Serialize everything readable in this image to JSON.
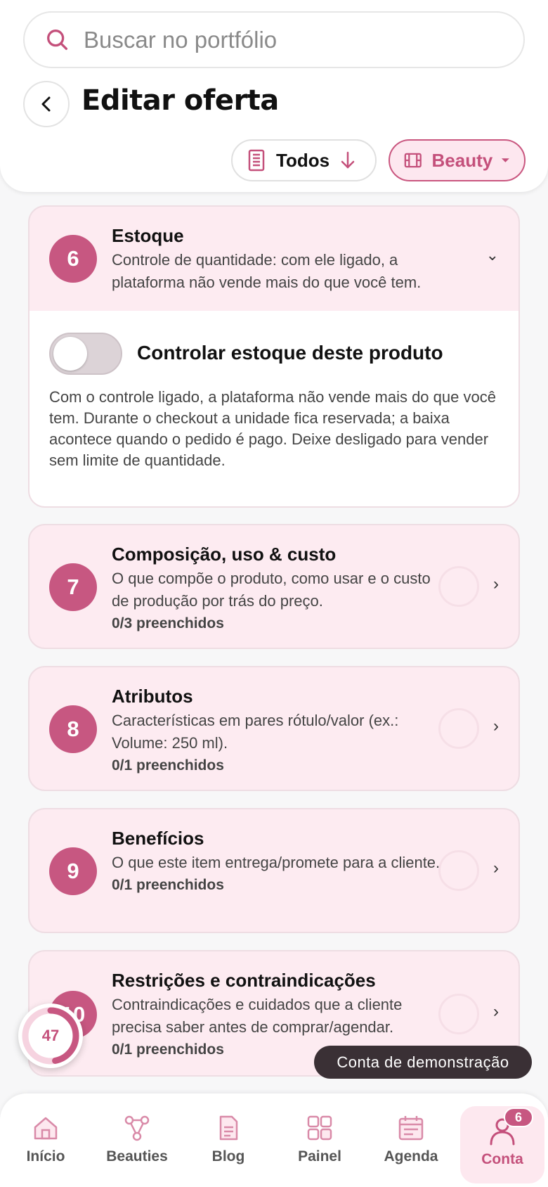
{
  "search": {
    "placeholder": "Buscar no portfólio"
  },
  "header": {
    "title": "Editar oferta"
  },
  "filters": {
    "todos_label": "Todos",
    "beauty_label": "Beauty"
  },
  "stock": {
    "number": "6",
    "title": "Estoque",
    "description": "Controle de quantidade: com ele ligado, a plataforma não vende mais do que você tem.",
    "toggle_label": "Controlar estoque deste produto",
    "toggle_on": false,
    "body": "Com o controle ligado, a plataforma não vende mais do que você tem. Durante o checkout a unidade fica reservada; a baixa acontece quando o pedido é pago. Deixe desligado para vender sem limite de quantidade."
  },
  "sections": [
    {
      "number": "7",
      "title": "Composição, uso & custo",
      "description": "O que compõe o produto, como usar e o custo de produção por trás do preço.",
      "count": "0/3 preenchidos"
    },
    {
      "number": "8",
      "title": "Atributos",
      "description": "Características em pares rótulo/valor (ex.: Volume: 250 ml).",
      "count": "0/1 preenchidos"
    },
    {
      "number": "9",
      "title": "Benefícios",
      "description": "O que este item entrega/promete para a cliente.",
      "count": "0/1 preenchidos"
    },
    {
      "number": "10",
      "title": "Restrições e contraindicações",
      "description": "Contraindicações e cuidados que a cliente precisa saber antes de comprar/agendar.",
      "count": "0/1 preenchidos"
    }
  ],
  "progress": {
    "value": "47",
    "fraction": 0.47
  },
  "demo_label": "Conta de demonstração",
  "nav": [
    {
      "label": "Início",
      "icon": "home-icon"
    },
    {
      "label": "Beauties",
      "icon": "network-icon"
    },
    {
      "label": "Blog",
      "icon": "document-icon"
    },
    {
      "label": "Painel",
      "icon": "grid-icon"
    },
    {
      "label": "Agenda",
      "icon": "calendar-icon"
    },
    {
      "label": "Conta",
      "icon": "user-icon",
      "badge": "6",
      "active": true
    }
  ],
  "colors": {
    "accent": "#c75781",
    "card_bg": "#fdebf1",
    "chip_bg": "#fde7ef"
  }
}
